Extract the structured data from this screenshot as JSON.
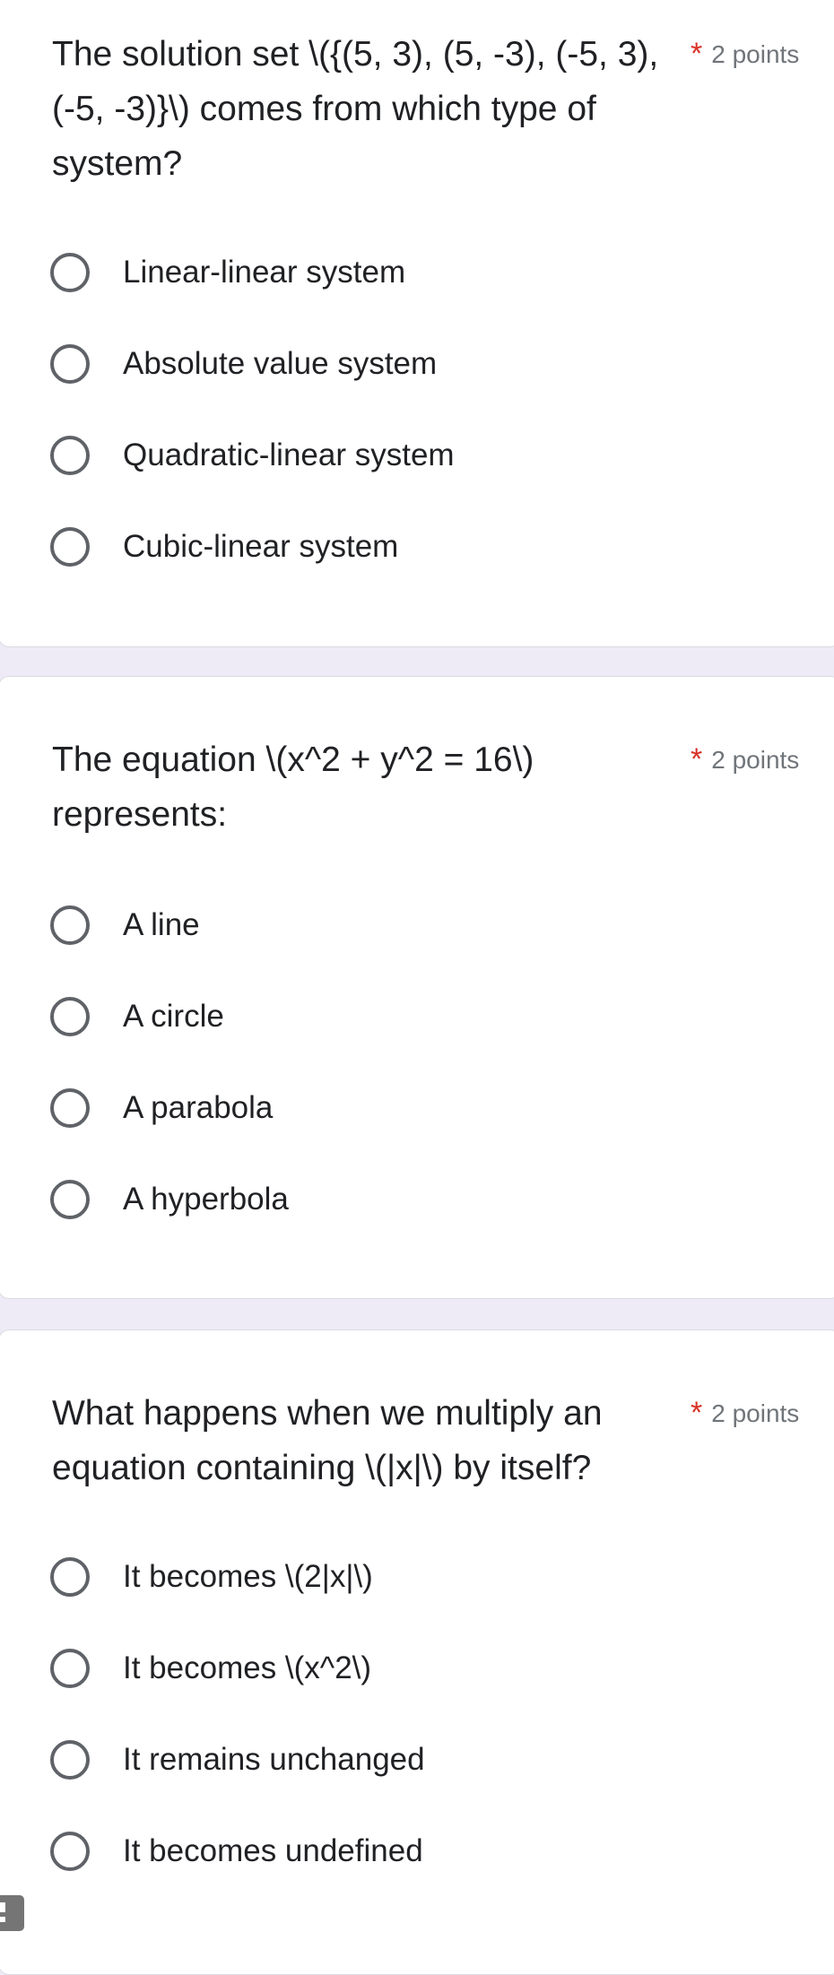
{
  "accent_colors": {
    "required_asterisk": "#d93025",
    "page_background": "#eeebf7",
    "radio_border": "#5f6368"
  },
  "questions": [
    {
      "title": "The solution set \\({(5, 3), (5, -3), (-5, 3), (-5, -3)}\\) comes from which type of system?",
      "title_lines": [
        "The solution set \\({(5, 3), (5, -3), (-5, 3),",
        "(-5, -3)}\\) comes from which type of",
        "system?"
      ],
      "required_marker": "*",
      "points": "2 points",
      "options": [
        "Linear-linear system",
        "Absolute value system",
        "Quadratic-linear system",
        "Cubic-linear system"
      ]
    },
    {
      "title": "The equation \\(x^2 + y^2 = 16\\) represents:",
      "title_lines": [
        "The equation \\(x^2 + y^2 = 16\\)",
        "represents:"
      ],
      "required_marker": "*",
      "points": "2 points",
      "options": [
        "A line",
        "A circle",
        "A parabola",
        "A hyperbola"
      ]
    },
    {
      "title": "What happens when we multiply an equation containing \\(|x|\\) by itself?",
      "title_lines": [
        "What happens when we multiply an",
        "equation containing \\(|x|\\) by itself?"
      ],
      "required_marker": "*",
      "points": "2 points",
      "options": [
        "It becomes \\(2|x|\\)",
        "It becomes \\(x^2\\)",
        "It remains unchanged",
        "It becomes undefined"
      ]
    }
  ],
  "feedback_button": {
    "icon": "report-icon"
  }
}
